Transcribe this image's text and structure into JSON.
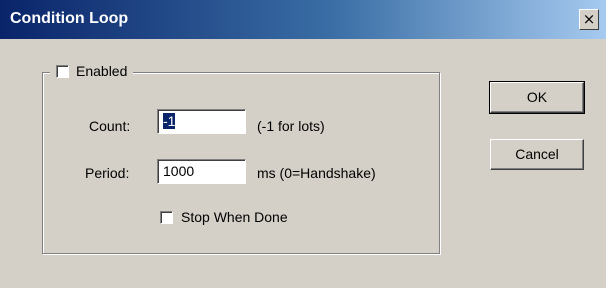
{
  "dialog": {
    "title": "Condition Loop",
    "close_label": "×"
  },
  "group": {
    "enabled_label": "Enabled",
    "enabled_checked": false
  },
  "count": {
    "label": "Count:",
    "value_selected": "-1",
    "hint": "(-1 for lots)"
  },
  "period": {
    "label": "Period:",
    "value": "1000",
    "hint": "ms (0=Handshake)"
  },
  "stop_when_done": {
    "label": "Stop When Done",
    "checked": false
  },
  "buttons": {
    "ok_label": "OK",
    "cancel_label": "Cancel"
  }
}
